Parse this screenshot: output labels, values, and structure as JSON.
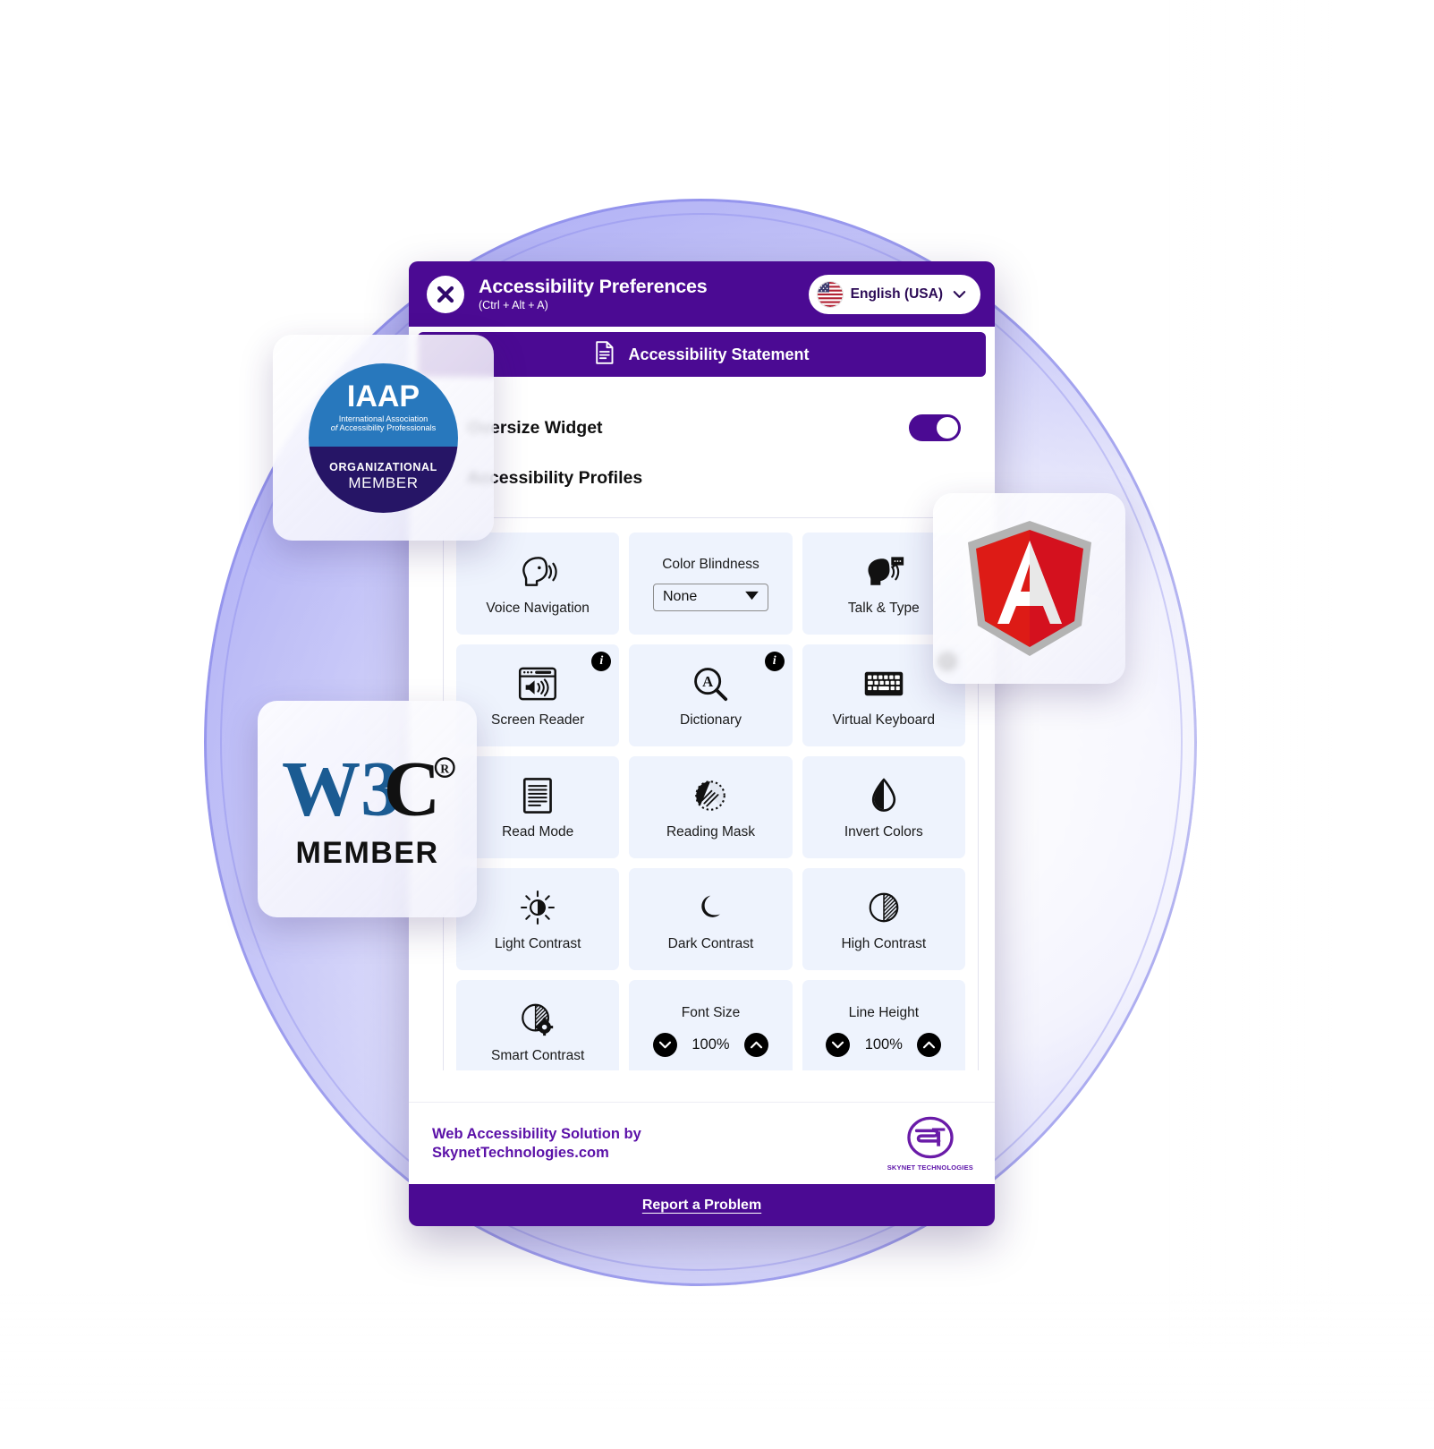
{
  "widget": {
    "header": {
      "title": "Accessibility Preferences",
      "shortcut": "(Ctrl + Alt + A)",
      "close_icon": "close-x-icon",
      "language": {
        "label": "English (USA)",
        "flag": "us-flag-icon",
        "chevron": "chevron-down-icon"
      }
    },
    "statement_button": {
      "label": "Accessibility Statement",
      "icon": "document-icon"
    },
    "oversize_widget": {
      "label": "Oversize Widget",
      "state": "on"
    },
    "profiles": {
      "label": "Accessibility Profiles"
    },
    "features": [
      {
        "id": "voice-navigation",
        "label": "Voice Navigation",
        "icon": "speaking-head-icon",
        "type": "toggle",
        "info": false
      },
      {
        "id": "color-blindness",
        "label": "Color Blindness",
        "icon": "none",
        "type": "select",
        "info": false,
        "value": "None",
        "dropdown_icon": "caret-down-icon"
      },
      {
        "id": "talk-and-type",
        "label": "Talk & Type",
        "icon": "talk-type-icon",
        "type": "toggle",
        "info": false
      },
      {
        "id": "screen-reader",
        "label": "Screen Reader",
        "icon": "screen-reader-icon",
        "type": "toggle",
        "info": true
      },
      {
        "id": "dictionary",
        "label": "Dictionary",
        "icon": "dictionary-icon",
        "type": "toggle",
        "info": true
      },
      {
        "id": "virtual-keyboard",
        "label": "Virtual Keyboard",
        "icon": "keyboard-icon",
        "type": "toggle",
        "info": true
      },
      {
        "id": "read-mode",
        "label": "Read Mode",
        "icon": "document-lines-icon",
        "type": "toggle",
        "info": false
      },
      {
        "id": "reading-mask",
        "label": "Reading Mask",
        "icon": "reading-mask-icon",
        "type": "toggle",
        "info": false
      },
      {
        "id": "invert-colors",
        "label": "Invert Colors",
        "icon": "droplet-half-icon",
        "type": "toggle",
        "info": false
      },
      {
        "id": "light-contrast",
        "label": "Light Contrast",
        "icon": "sun-half-icon",
        "type": "toggle",
        "info": false
      },
      {
        "id": "dark-contrast",
        "label": "Dark Contrast",
        "icon": "moon-icon",
        "type": "toggle",
        "info": false
      },
      {
        "id": "high-contrast",
        "label": "High Contrast",
        "icon": "circle-half-icon",
        "type": "toggle",
        "info": false
      },
      {
        "id": "smart-contrast",
        "label": "Smart Contrast",
        "icon": "circle-gear-icon",
        "type": "toggle",
        "info": false
      },
      {
        "id": "font-size",
        "label": "Font Size",
        "icon": "none",
        "type": "stepper",
        "info": false,
        "value": "100%",
        "decrease_icon": "chevron-down-circle-icon",
        "increase_icon": "chevron-up-circle-icon"
      },
      {
        "id": "line-height",
        "label": "Line Height",
        "icon": "none",
        "type": "stepper",
        "info": false,
        "value": "100%",
        "decrease_icon": "chevron-down-circle-icon",
        "increase_icon": "chevron-up-circle-icon"
      }
    ],
    "footer": {
      "credit_line1": "Web Accessibility Solution by",
      "credit_line2": "SkynetTechnologies.com",
      "logo_mark": "ST",
      "logo_caption": "SKYNET TECHNOLOGIES"
    },
    "bottom_bar": {
      "report_label": "Report a Problem"
    }
  },
  "badges": {
    "iaap": {
      "acronym": "IAAP",
      "line1": "International Association",
      "line2_italic": "of",
      "line2": "Accessibility Professionals",
      "tier": "ORGANIZATIONAL",
      "member": "MEMBER"
    },
    "w3c": {
      "logo_text": "W3C",
      "trademark": "®",
      "member": "MEMBER"
    },
    "angular": {
      "name": "Angular",
      "letter": "A"
    }
  },
  "colors": {
    "primary_purple": "#4b0a93",
    "tile_bg": "#eef3fd",
    "footer_text": "#5b11a8",
    "iaap_blue": "#2878bd",
    "iaap_navy": "#261566",
    "w3c_blue": "#1b5b92",
    "angular_red": "#dd1b16"
  }
}
